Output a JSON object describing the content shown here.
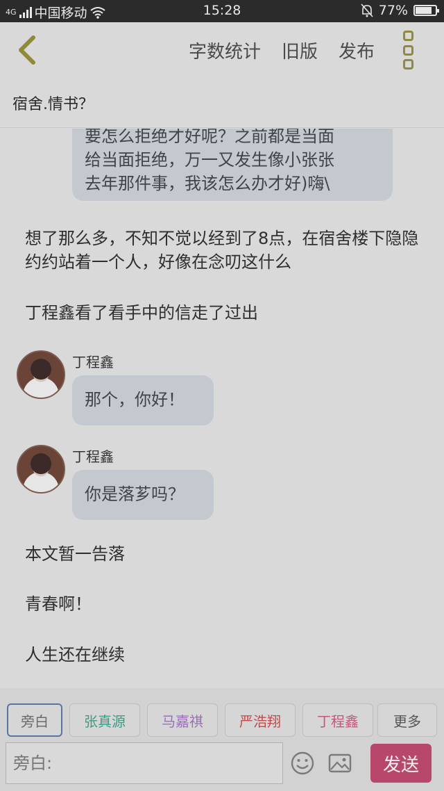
{
  "status_bar": {
    "network": "4G",
    "carrier": "中国移动",
    "time": "15:28",
    "battery": "77%",
    "battery_level": 0.77
  },
  "nav": {
    "actions": [
      "字数统计",
      "旧版",
      "发布"
    ]
  },
  "title": "宿舍.情书？",
  "messages": {
    "bubble_top": [
      "要怎么拒绝才好呢？之前都是当面",
      "给当面拒绝，万一又发生像小张张",
      "去年那件事，我该怎么办才好)嗨\\"
    ],
    "narration_1": "想了那么多，不知不觉以经到了8点，在宿舍楼下隐隐约约站着一个人，好像在念叨这什么",
    "narration_2": "丁程鑫看了看手中的信走了过出",
    "chat_1": {
      "speaker": "丁程鑫",
      "text": "那个，你好！"
    },
    "chat_2": {
      "speaker": "丁程鑫",
      "text": "你是落芗吗？"
    },
    "narration_3": "本文暂一告落",
    "narration_4": "青春啊！",
    "narration_5": "人生还在继续"
  },
  "roles": [
    {
      "label": "旁白",
      "color": "#6a6a6a"
    },
    {
      "label": "张真源",
      "color": "#3f9a84"
    },
    {
      "label": "马嘉祺",
      "color": "#9a6fb8"
    },
    {
      "label": "严浩翔",
      "color": "#c24a4a"
    },
    {
      "label": "丁程鑫",
      "color": "#c2577e"
    },
    {
      "label": "更多",
      "color": "#555555"
    }
  ],
  "input": {
    "placeholder": "旁白:",
    "send_label": "发送"
  },
  "colors": {
    "accent": "#b7486c",
    "more_icon": "#8f8a3c"
  }
}
